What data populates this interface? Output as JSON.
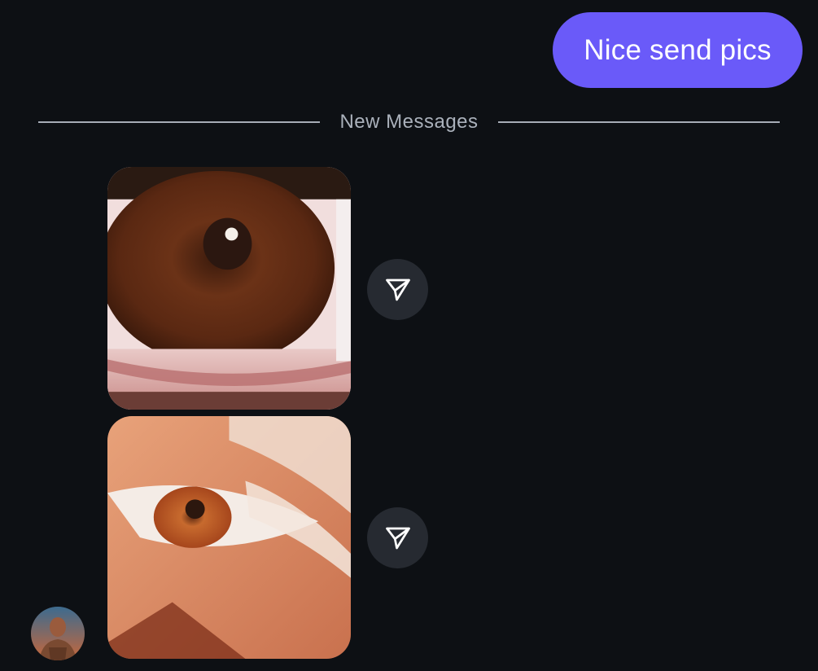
{
  "messages": {
    "sent": {
      "text": "Nice send pics"
    },
    "divider": {
      "label": "New Messages"
    },
    "received": [
      {
        "type": "image",
        "subject": "close-up brown eye photo"
      },
      {
        "type": "image",
        "subject": "close-up eye with light lashes photo"
      }
    ]
  },
  "icons": {
    "share": "send-arrow-icon",
    "avatar": "user-avatar"
  },
  "colors": {
    "background": "#0d1014",
    "sent_bubble": "#6a5af9",
    "divider": "#b7bec8",
    "share_button": "#262a31"
  }
}
